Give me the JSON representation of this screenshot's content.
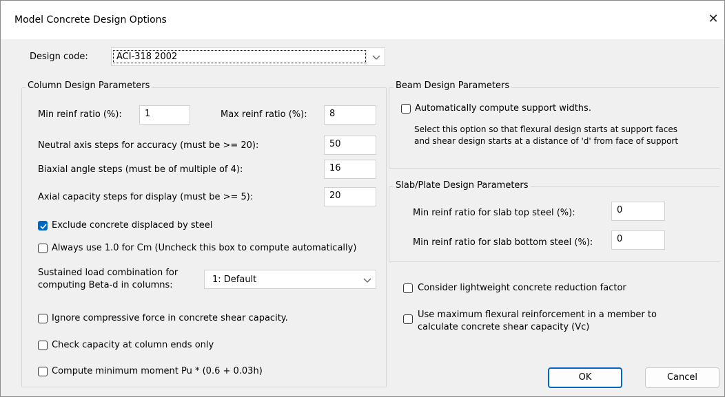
{
  "window": {
    "title": "Model Concrete Design Options",
    "close_glyph": "✕"
  },
  "design_code": {
    "label": "Design code:",
    "value": "ACI-318 2002"
  },
  "column": {
    "group_title": "Column Design Parameters",
    "min_reinf_label": "Min reinf ratio (%):",
    "min_reinf_value": "1",
    "max_reinf_label": "Max reinf ratio (%):",
    "max_reinf_value": "8",
    "neutral_axis_label": "Neutral axis steps for accuracy (must be >= 20):",
    "neutral_axis_value": "50",
    "biaxial_label": "Biaxial angle steps (must be of multiple of 4):",
    "biaxial_value": "16",
    "axial_label": "Axial capacity steps for display (must be >= 5):",
    "axial_value": "20",
    "exclude_concrete_label": "Exclude concrete displaced by steel",
    "exclude_concrete_checked": true,
    "always_cm_label": "Always use 1.0 for Cm (Uncheck this box to compute automatically)",
    "always_cm_checked": false,
    "sustained_label_line1": "Sustained load combination for",
    "sustained_label_line2": "computing Beta-d in columns:",
    "sustained_value": "1: Default",
    "ignore_compressive_label": "Ignore compressive force in concrete shear capacity.",
    "ignore_compressive_checked": false,
    "check_capacity_label": "Check capacity at column ends only",
    "check_capacity_checked": false,
    "compute_min_moment_label": "Compute minimum moment Pu * (0.6 + 0.03h)",
    "compute_min_moment_checked": false
  },
  "beam": {
    "group_title": "Beam Design Parameters",
    "auto_support_label": "Automatically compute support widths.",
    "auto_support_checked": false,
    "description_line1": "Select this option so that flexural design starts at support faces",
    "description_line2": "and shear design starts at a distance of 'd' from face of support"
  },
  "slab": {
    "group_title": "Slab/Plate Design Parameters",
    "top_steel_label": "Min reinf ratio for slab top steel (%):",
    "top_steel_value": "0",
    "bottom_steel_label": "Min reinf ratio for slab bottom steel (%):",
    "bottom_steel_value": "0"
  },
  "general": {
    "lightweight_label": "Consider lightweight concrete reduction factor",
    "lightweight_checked": false,
    "max_flexural_line1": "Use maximum flexural reinforcement in a member to",
    "max_flexural_line2": "calculate concrete shear capacity (Vc)",
    "max_flexural_checked": false
  },
  "buttons": {
    "ok": "OK",
    "cancel": "Cancel"
  },
  "colors": {
    "accent": "#0067c0",
    "dialog_bg": "#f0f0f0",
    "titlebar_bg": "#ffffff"
  }
}
